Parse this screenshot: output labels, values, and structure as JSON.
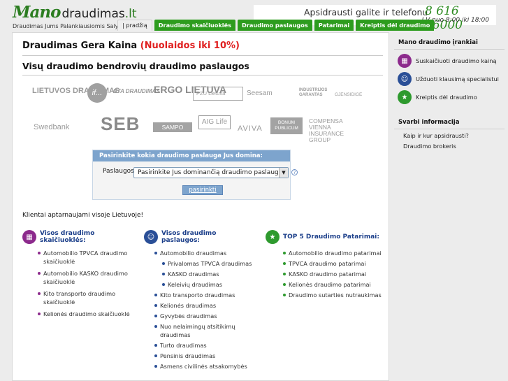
{
  "header": {
    "logo_mano": "Mano",
    "logo_domain": "draudimas",
    "logo_tld": ".lt",
    "slogan": "Draudimas Jums Palankiausiomis Salygomis",
    "phone_text": "Apsidrausti galite ir telefonu",
    "phone_number": "8 616 16000",
    "hours": "I-V nuo 8:00 iki 18:00"
  },
  "nav": {
    "tabs": [
      {
        "label": "| pradžią"
      },
      {
        "label": "Draudimo skaičiuoklės"
      },
      {
        "label": "Draudimo paslaugos"
      },
      {
        "label": "Patarimai"
      },
      {
        "label": "Kreiptis dėl draudimo"
      }
    ]
  },
  "main": {
    "title": "Draudimas Gera Kaina",
    "title_highlight": "(Nuolaidos iki 10%)",
    "subtitle": "Visų draudimo bendrovių draudimo paslaugos",
    "logos": [
      "LIETUVOS DRAUDIMAS",
      "if...",
      "BTA DRAUDIMAS",
      "ERGO LIETUVA",
      "PZU Lietuva",
      "Seesam",
      "INDUSTRIJOS GARANTAS",
      "GJENSIDIGE",
      "Swedbank",
      "SEB",
      "SAMPO",
      "AIG Life",
      "AVIVA",
      "BONUM PUBLICUM",
      "COMPENSA VIENNA INSURANCE GROUP"
    ],
    "form": {
      "heading": "Pasirinkite kokia draudimo paslauga Jus domina:",
      "label": "Paslaugos:",
      "select_value": "Pasirinkite Jus dominančią draudimo paslaugą",
      "help": "?",
      "submit": "pasirinkti"
    },
    "note": "Klientai aptarnaujami visoje Lietuvoje!",
    "col1": {
      "heading": "Visos draudimo skaičiuoklės:",
      "items": [
        "Automobilio TPVCA draudimo skaičiuoklė",
        "Automobilio KASKO draudimo skaičiuoklė",
        "Kito transporto draudimo skaičiuoklė",
        "Kelionės draudimo skaičiuoklė"
      ]
    },
    "col2": {
      "heading": "Visos draudimo paslaugos:",
      "items": [
        "Automobilio draudimas",
        "Privalomas TPVCA draudimas",
        "KASKO draudimas",
        "Keleivių draudimas",
        "Kito transporto draudimas",
        "Kelionės draudimas",
        "Gyvybės draudimas",
        "Nuo nelaimingų atsitikimų draudimas",
        "Turto draudimas",
        "Pensinis draudimas",
        "Asmens civilinės atsakomybės"
      ]
    },
    "col3": {
      "heading": "TOP 5 Draudimo Patarimai:",
      "items": [
        "Automobilio draudimo patarimai",
        "TPVCA draudimo patarimai",
        "KASKO draudimo patarimai",
        "Kelionės draudimo patarimai",
        "Draudimo sutarties nutraukimas"
      ]
    }
  },
  "sidebar": {
    "title": "Mano draudimo įrankiai",
    "tools": [
      {
        "label": "Suskaičiuoti draudimo kainą",
        "icon": "calculator-icon"
      },
      {
        "label": "Užduoti klausimą specialistui",
        "icon": "specialist-icon"
      },
      {
        "label": "Kreiptis dėl draudimo",
        "icon": "star-icon"
      }
    ],
    "info_title": "Svarbi informacija",
    "info_links": [
      "Kaip ir kur apsidrausti?",
      "Draudimo brokeris"
    ]
  },
  "colors": {
    "accent_green": "#2d9c1e",
    "link_blue": "#1c3f8a",
    "highlight_red": "#e02020",
    "form_blue": "#7da4cd"
  }
}
